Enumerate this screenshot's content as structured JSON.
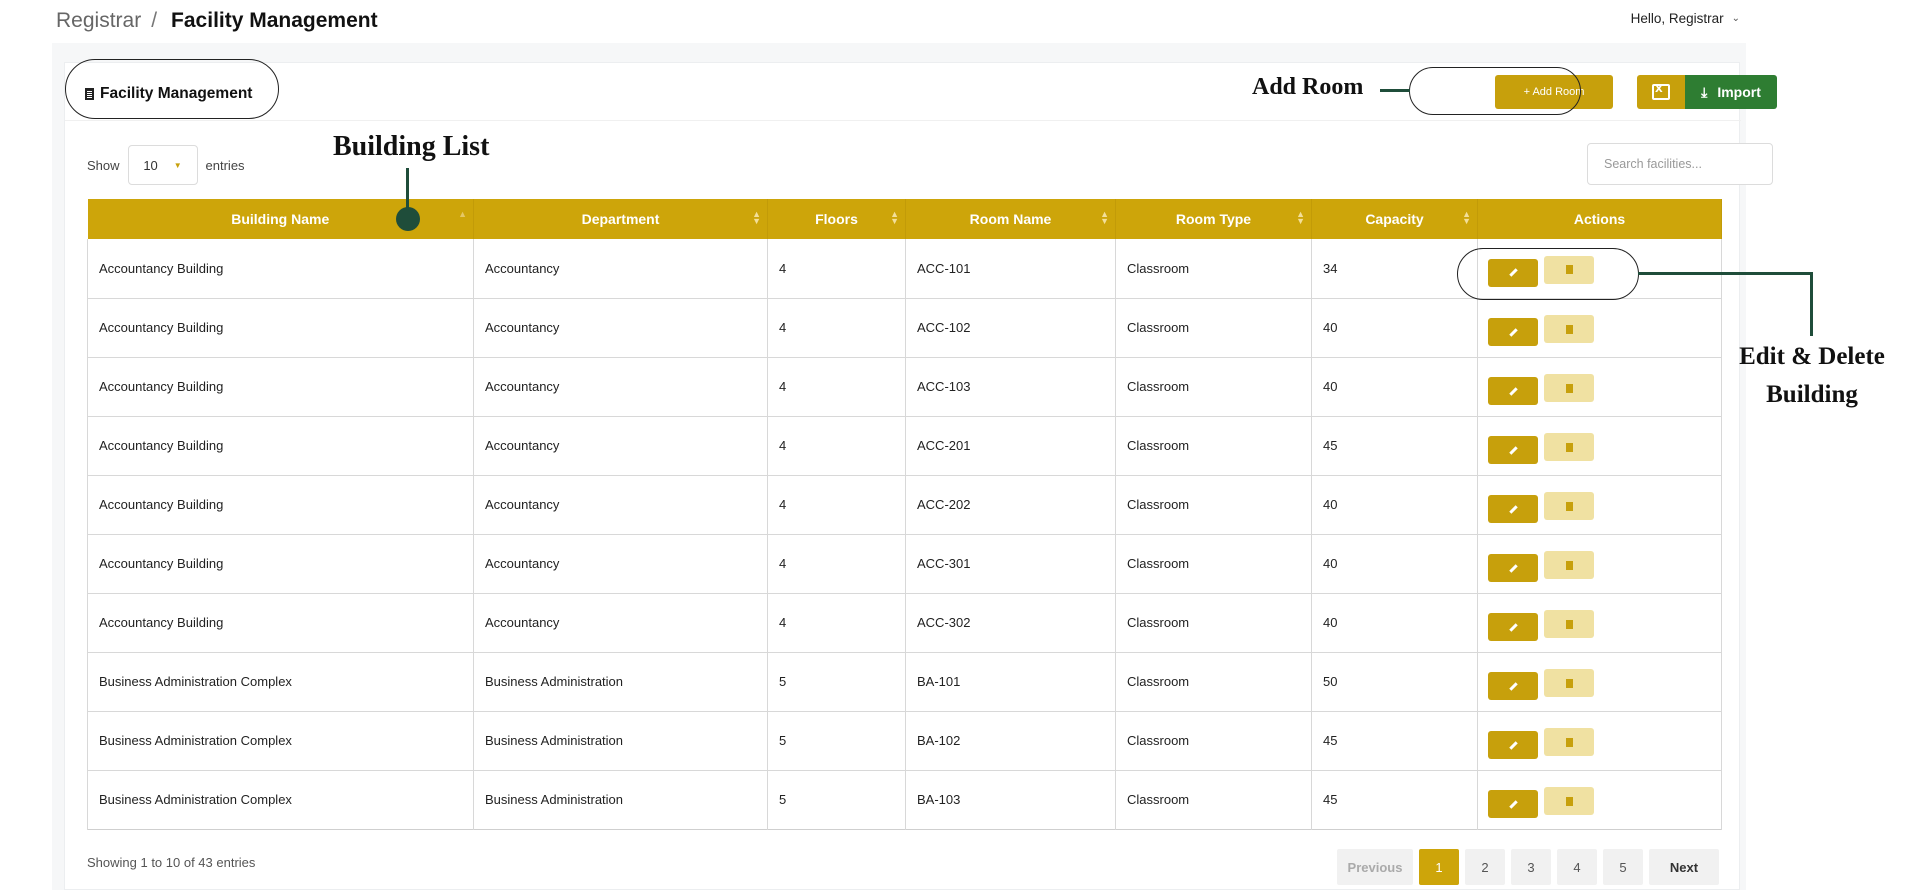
{
  "breadcrumb": {
    "root": "Registrar",
    "separator": "/",
    "current": "Facility Management"
  },
  "user_menu": {
    "greeting": "Hello, Registrar"
  },
  "card": {
    "title": "Facility Management"
  },
  "toolbar": {
    "add_room_label": "+ Add Room",
    "import_label": "Import"
  },
  "show_entries": {
    "prefix": "Show",
    "value": "10",
    "suffix": "entries"
  },
  "search": {
    "placeholder": "Search facilities..."
  },
  "table": {
    "columns": [
      "Building Name",
      "Department",
      "Floors",
      "Room Name",
      "Room Type",
      "Capacity",
      "Actions"
    ],
    "rows": [
      {
        "building": "Accountancy Building",
        "department": "Accountancy",
        "floors": "4",
        "room": "ACC-101",
        "type": "Classroom",
        "capacity": "34"
      },
      {
        "building": "Accountancy Building",
        "department": "Accountancy",
        "floors": "4",
        "room": "ACC-102",
        "type": "Classroom",
        "capacity": "40"
      },
      {
        "building": "Accountancy Building",
        "department": "Accountancy",
        "floors": "4",
        "room": "ACC-103",
        "type": "Classroom",
        "capacity": "40"
      },
      {
        "building": "Accountancy Building",
        "department": "Accountancy",
        "floors": "4",
        "room": "ACC-201",
        "type": "Classroom",
        "capacity": "45"
      },
      {
        "building": "Accountancy Building",
        "department": "Accountancy",
        "floors": "4",
        "room": "ACC-202",
        "type": "Classroom",
        "capacity": "40"
      },
      {
        "building": "Accountancy Building",
        "department": "Accountancy",
        "floors": "4",
        "room": "ACC-301",
        "type": "Classroom",
        "capacity": "40"
      },
      {
        "building": "Accountancy Building",
        "department": "Accountancy",
        "floors": "4",
        "room": "ACC-302",
        "type": "Classroom",
        "capacity": "40"
      },
      {
        "building": "Business Administration Complex",
        "department": "Business Administration",
        "floors": "5",
        "room": "BA-101",
        "type": "Classroom",
        "capacity": "50"
      },
      {
        "building": "Business Administration Complex",
        "department": "Business Administration",
        "floors": "5",
        "room": "BA-102",
        "type": "Classroom",
        "capacity": "45"
      },
      {
        "building": "Business Administration Complex",
        "department": "Business Administration",
        "floors": "5",
        "room": "BA-103",
        "type": "Classroom",
        "capacity": "45"
      }
    ]
  },
  "footer": {
    "info": "Showing 1 to 10 of 43 entries"
  },
  "pagination": {
    "previous": "Previous",
    "pages": [
      "1",
      "2",
      "3",
      "4",
      "5"
    ],
    "active_page": "1",
    "next": "Next"
  },
  "annotations": {
    "add_room": "Add Room",
    "building_list": "Building List",
    "edit_delete_line1": "Edit & Delete",
    "edit_delete_line2": "Building"
  },
  "colors": {
    "accent": "#cda50a",
    "accent_light": "#f0e1a2",
    "import_green": "#2e7d32",
    "annotation_line": "#1f4d3a"
  }
}
